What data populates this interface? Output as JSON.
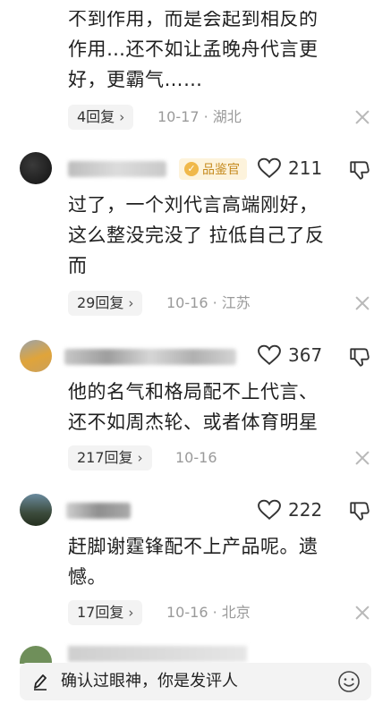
{
  "comments": [
    {
      "text_lines": [
        "不到作用，而是会起到相反的",
        "作用…还不如让孟晚舟代言更",
        "好，更霸气……"
      ],
      "replies": "4回复",
      "meta": "10-17 · 湖北"
    },
    {
      "badge": "品鉴官",
      "likes": "211",
      "text_lines": [
        "过了，一个刘代言高端刚好，",
        "这么整没完没了 拉低自己了反",
        "而"
      ],
      "replies": "29回复",
      "meta": "10-16 · 江苏"
    },
    {
      "likes": "367",
      "text_lines": [
        "他的名气和格局配不上代言、",
        "还不如周杰轮、或者体育明星"
      ],
      "replies": "217回复",
      "meta": "10-16"
    },
    {
      "likes": "222",
      "text_lines": [
        "赶脚谢霆锋配不上产品呢。遗",
        "憾。"
      ],
      "replies": "17回复",
      "meta": "10-16 · 北京"
    }
  ],
  "input": {
    "placeholder": "确认过眼神，你是发评人"
  },
  "icons": {
    "like": "heart-outline-icon",
    "dislike": "thumbs-down-icon",
    "close": "close-icon",
    "emoji": "smiley-icon",
    "pen": "pen-icon",
    "badge": "verified-badge-icon"
  },
  "colors": {
    "badge_bg": "#fdf3dc",
    "badge_text": "#c58a1e",
    "meta_gray": "#9a9a9a",
    "pill_bg": "#f3f3f3"
  }
}
